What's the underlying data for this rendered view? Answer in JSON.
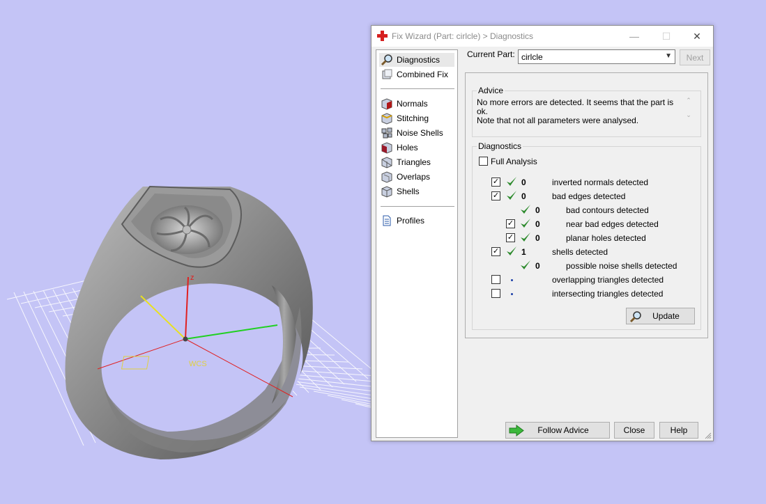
{
  "dialog": {
    "title": "Fix Wizard (Part: cirlcle) > Diagnostics",
    "controls": {
      "minimize": "—",
      "maximize": "☐",
      "close": "✕"
    }
  },
  "sidebar": {
    "items": [
      {
        "label": "Diagnostics",
        "icon": "magnifier-icon"
      },
      {
        "label": "Combined Fix",
        "icon": "cube-stack-icon"
      },
      {
        "label": "Normals",
        "icon": "cube-red-icon"
      },
      {
        "label": "Stitching",
        "icon": "cube-stitch-icon"
      },
      {
        "label": "Noise Shells",
        "icon": "noise-shells-icon"
      },
      {
        "label": "Holes",
        "icon": "cube-holes-icon"
      },
      {
        "label": "Triangles",
        "icon": "triangles-icon"
      },
      {
        "label": "Overlaps",
        "icon": "overlaps-icon"
      },
      {
        "label": "Shells",
        "icon": "shells-icon"
      },
      {
        "label": "Profiles",
        "icon": "document-icon"
      }
    ]
  },
  "current_part": {
    "label": "Current Part:",
    "value": "cirlcle",
    "next_label": "Next"
  },
  "advice": {
    "legend": "Advice",
    "line1": "No more errors are detected. It seems that the part is ok.",
    "line2": "Note that not all parameters were analysed."
  },
  "diagnostics": {
    "legend": "Diagnostics",
    "full_analysis": "Full Analysis",
    "rows": [
      {
        "checked": true,
        "status": "ok",
        "count": "0",
        "label": "inverted normals detected"
      },
      {
        "checked": true,
        "status": "ok",
        "count": "0",
        "label": "bad edges detected"
      },
      {
        "checked": null,
        "status": "ok",
        "count": "0",
        "label": "bad contours detected"
      },
      {
        "checked": true,
        "status": "ok",
        "count": "0",
        "label": "near bad edges detected"
      },
      {
        "checked": true,
        "status": "ok",
        "count": "0",
        "label": "planar holes detected"
      },
      {
        "checked": true,
        "status": "ok",
        "count": "1",
        "label": "shells detected"
      },
      {
        "checked": null,
        "status": "ok",
        "count": "0",
        "label": "possible noise shells detected"
      },
      {
        "checked": false,
        "status": "none",
        "count": "",
        "label": "overlapping triangles detected"
      },
      {
        "checked": false,
        "status": "none",
        "count": "",
        "label": "intersecting triangles detected"
      }
    ],
    "update_label": "Update"
  },
  "footer": {
    "follow_advice": "Follow Advice",
    "close": "Close",
    "help": "Help"
  },
  "viewport": {
    "axis_z_label": "z",
    "wcs_label": "WCS"
  },
  "colors": {
    "background": "#c4c4f6",
    "check_green": "#2e8b2e",
    "axis_x": "#e02020",
    "axis_y": "#20d020",
    "axis_z": "#e8e020"
  }
}
